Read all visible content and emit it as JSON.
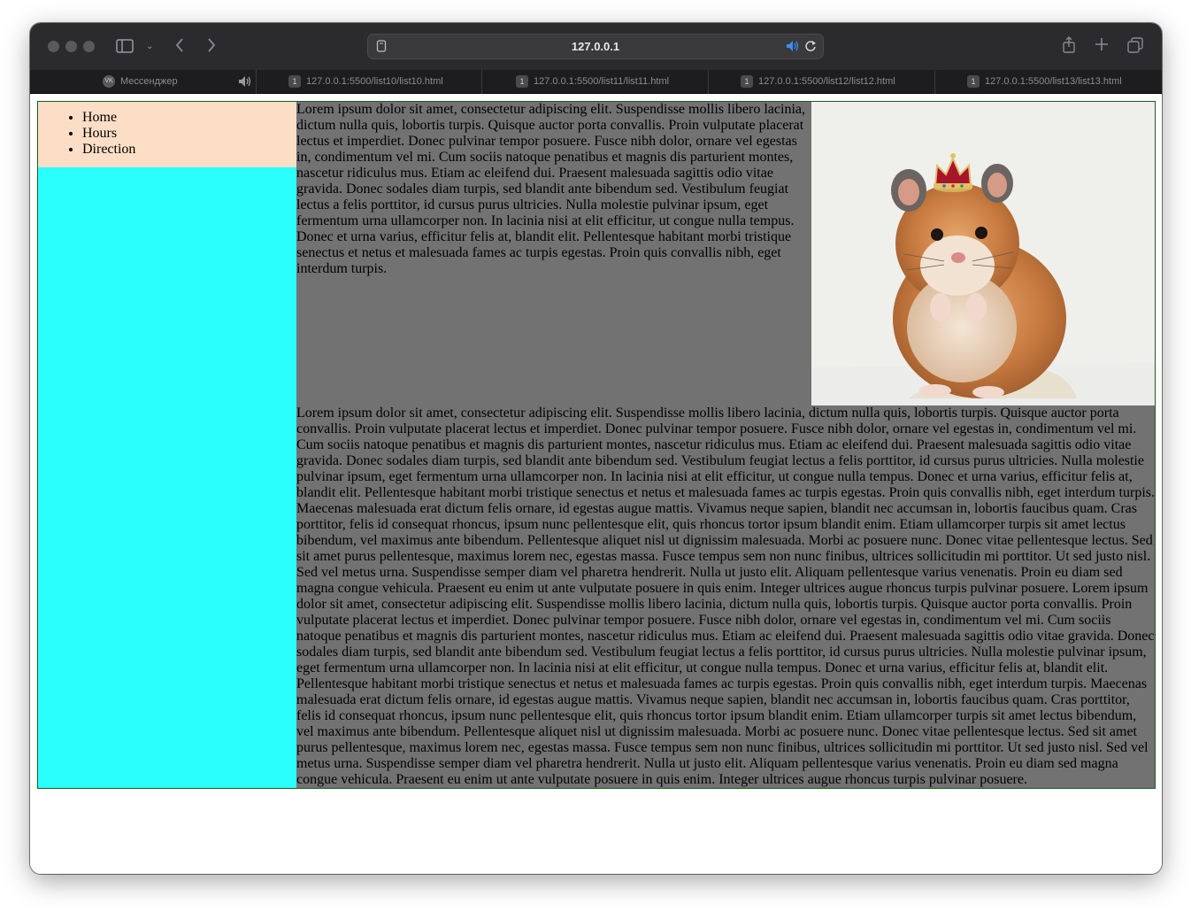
{
  "browser": {
    "address": "127.0.0.1",
    "tabs": [
      {
        "label": "Мессенджер",
        "badge": "VK"
      },
      {
        "label": "127.0.0.1:5500/list10/list10.html",
        "badge": "1"
      },
      {
        "label": "127.0.0.1:5500/list11/list11.html",
        "badge": "1"
      },
      {
        "label": "127.0.0.1:5500/list12/list12.html",
        "badge": "1"
      },
      {
        "label": "127.0.0.1:5500/list13/list13.html",
        "badge": "1"
      }
    ]
  },
  "nav": {
    "items": [
      "Home",
      "Hours",
      "Direction"
    ]
  },
  "main": {
    "para1": "Lorem ipsum dolor sit amet, consectetur adipiscing elit. Suspendisse mollis libero lacinia, dictum nulla quis, lobortis turpis. Quisque auctor porta convallis. Proin vulputate placerat lectus et imperdiet. Donec pulvinar tempor posuere. Fusce nibh dolor, ornare vel egestas in, condimentum vel mi. Cum sociis natoque penatibus et magnis dis parturient montes, nascetur ridiculus mus. Etiam ac eleifend dui. Praesent malesuada sagittis odio vitae gravida. Donec sodales diam turpis, sed blandit ante bibendum sed. Vestibulum feugiat lectus a felis porttitor, id cursus purus ultricies. Nulla molestie pulvinar ipsum, eget fermentum urna ullamcorper non. In lacinia nisi at elit efficitur, ut congue nulla tempus. Donec et urna varius, efficitur felis at, blandit elit. Pellentesque habitant morbi tristique senectus et netus et malesuada fames ac turpis egestas. Proin quis convallis nibh, eget interdum turpis.",
    "para2": "Lorem ipsum dolor sit amet, consectetur adipiscing elit. Suspendisse mollis libero lacinia, dictum nulla quis, lobortis turpis. Quisque auctor porta convallis. Proin vulputate placerat lectus et imperdiet. Donec pulvinar tempor posuere. Fusce nibh dolor, ornare vel egestas in, condimentum vel mi. Cum sociis natoque penatibus et magnis dis parturient montes, nascetur ridiculus mus. Etiam ac eleifend dui. Praesent malesuada sagittis odio vitae gravida. Donec sodales diam turpis, sed blandit ante bibendum sed. Vestibulum feugiat lectus a felis porttitor, id cursus purus ultricies. Nulla molestie pulvinar ipsum, eget fermentum urna ullamcorper non. In lacinia nisi at elit efficitur, ut congue nulla tempus. Donec et urna varius, efficitur felis at, blandit elit. Pellentesque habitant morbi tristique senectus et netus et malesuada fames ac turpis egestas. Proin quis convallis nibh, eget interdum turpis. Maecenas malesuada erat dictum felis ornare, id egestas augue mattis. Vivamus neque sapien, blandit nec accumsan in, lobortis faucibus quam. Cras porttitor, felis id consequat rhoncus, ipsum nunc pellentesque elit, quis rhoncus tortor ipsum blandit enim. Etiam ullamcorper turpis sit amet lectus bibendum, vel maximus ante bibendum. Pellentesque aliquet nisl ut dignissim malesuada. Morbi ac posuere nunc. Donec vitae pellentesque lectus. Sed sit amet purus pellentesque, maximus lorem nec, egestas massa. Fusce tempus sem non nunc finibus, ultrices sollicitudin mi porttitor. Ut sed justo nisl. Sed vel metus urna. Suspendisse semper diam vel pharetra hendrerit. Nulla ut justo elit. Aliquam pellentesque varius venenatis. Proin eu diam sed magna congue vehicula. Praesent eu enim ut ante vulputate posuere in quis enim. Integer ultrices augue rhoncus turpis pulvinar posuere. Lorem ipsum dolor sit amet, consectetur adipiscing elit. Suspendisse mollis libero lacinia, dictum nulla quis, lobortis turpis. Quisque auctor porta convallis. Proin vulputate placerat lectus et imperdiet. Donec pulvinar tempor posuere. Fusce nibh dolor, ornare vel egestas in, condimentum vel mi. Cum sociis natoque penatibus et magnis dis parturient montes, nascetur ridiculus mus. Etiam ac eleifend dui. Praesent malesuada sagittis odio vitae gravida. Donec sodales diam turpis, sed blandit ante bibendum sed. Vestibulum feugiat lectus a felis porttitor, id cursus purus ultricies. Nulla molestie pulvinar ipsum, eget fermentum urna ullamcorper non. In lacinia nisi at elit efficitur, ut congue nulla tempus. Donec et urna varius, efficitur felis at, blandit elit. Pellentesque habitant morbi tristique senectus et netus et malesuada fames ac turpis egestas. Proin quis convallis nibh, eget interdum turpis. Maecenas malesuada erat dictum felis ornare, id egestas augue mattis. Vivamus neque sapien, blandit nec accumsan in, lobortis faucibus quam. Cras porttitor, felis id consequat rhoncus, ipsum nunc pellentesque elit, quis rhoncus tortor ipsum blandit enim. Etiam ullamcorper turpis sit amet lectus bibendum, vel maximus ante bibendum. Pellentesque aliquet nisl ut dignissim malesuada. Morbi ac posuere nunc. Donec vitae pellentesque lectus. Sed sit amet purus pellentesque, maximus lorem nec, egestas massa. Fusce tempus sem non nunc finibus, ultrices sollicitudin mi porttitor. Ut sed justo nisl. Sed vel metus urna. Suspendisse semper diam vel pharetra hendrerit. Nulla ut justo elit. Aliquam pellentesque varius venenatis. Proin eu diam sed magna congue vehicula. Praesent eu enim ut ante vulputate posuere in quis enim. Integer ultrices augue rhoncus turpis pulvinar posuere."
  },
  "image": {
    "icon": "hamster-with-crown"
  },
  "colors": {
    "sidebar": "#2bfffd",
    "nav": "#fbdec5",
    "main": "#727272"
  }
}
